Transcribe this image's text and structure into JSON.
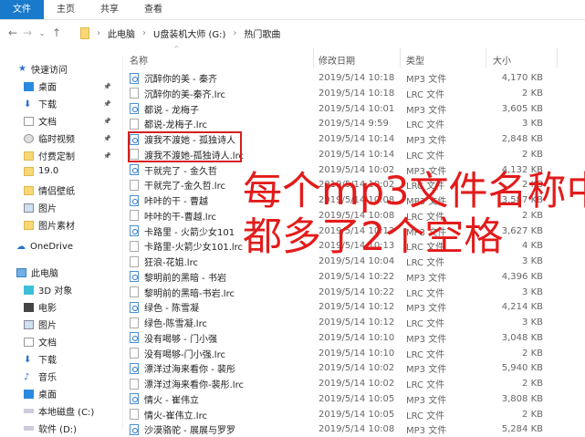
{
  "ribbon": {
    "tabs": [
      "文件",
      "主页",
      "共享",
      "查看"
    ]
  },
  "address": {
    "crumbs": [
      "此电脑",
      "U盘装机大师 (G:)",
      "热门歌曲"
    ]
  },
  "sidebar": {
    "quick_access": "快速访问",
    "items": [
      {
        "label": "桌面",
        "icon": "desktop-icon",
        "pinned": true
      },
      {
        "label": "下载",
        "icon": "download-icon",
        "pinned": true
      },
      {
        "label": "文档",
        "icon": "document-icon",
        "pinned": true
      },
      {
        "label": "临时视频",
        "icon": "disc-icon",
        "pinned": true
      },
      {
        "label": "付费定制",
        "icon": "folder-icon",
        "pinned": true
      },
      {
        "label": "19.0",
        "icon": "folder-icon",
        "pinned": false
      },
      {
        "label": "情侣壁纸",
        "icon": "folder-icon",
        "pinned": false
      },
      {
        "label": "图片",
        "icon": "pictures-icon",
        "pinned": false
      },
      {
        "label": "图片素材",
        "icon": "folder-icon",
        "pinned": false
      }
    ],
    "onedrive": "OneDrive",
    "this_pc": "此电脑",
    "pc_items": [
      {
        "label": "3D 对象",
        "icon": "cube-icon"
      },
      {
        "label": "电影",
        "icon": "video-icon"
      },
      {
        "label": "图片",
        "icon": "pictures-icon"
      },
      {
        "label": "文档",
        "icon": "document-icon"
      },
      {
        "label": "下载",
        "icon": "download-icon"
      },
      {
        "label": "音乐",
        "icon": "music-icon"
      },
      {
        "label": "桌面",
        "icon": "desktop-icon"
      },
      {
        "label": "本地磁盘 (C:)",
        "icon": "drive-icon"
      },
      {
        "label": "软件 (D:)",
        "icon": "drive-icon"
      }
    ]
  },
  "columns": {
    "name": "名称",
    "date": "修改日期",
    "type": "类型",
    "size": "大小"
  },
  "files": [
    {
      "name": "沉醉你的美 - 秦齐",
      "date": "2019/5/14 10:18",
      "type": "MP3 文件",
      "size": "4,170 KB"
    },
    {
      "name": "沉醉你的美-秦齐.lrc",
      "date": "2019/5/14 10:18",
      "type": "LRC 文件",
      "size": "2 KB"
    },
    {
      "name": "都说 - 龙梅子",
      "date": "2019/5/14 10:01",
      "type": "MP3 文件",
      "size": "3,605 KB"
    },
    {
      "name": "都说-龙梅子.lrc",
      "date": "2019/5/14 9:59",
      "type": "LRC 文件",
      "size": "3 KB"
    },
    {
      "name": "渡我不渡她 - 孤独诗人",
      "date": "2019/5/14 10:14",
      "type": "MP3 文件",
      "size": "2,848 KB"
    },
    {
      "name": "渡我不渡她-孤独诗人.lrc",
      "date": "2019/5/14 10:14",
      "type": "LRC 文件",
      "size": "2 KB"
    },
    {
      "name": "干就完了 - 金久哲",
      "date": "2019/5/14 10:02",
      "type": "MP3 文件",
      "size": "4,132 KB"
    },
    {
      "name": "干就完了-金久哲.lrc",
      "date": "2019/5/14 10:02",
      "type": "LRC 文件",
      "size": "2 KB"
    },
    {
      "name": "咔咔的干 - 曹越",
      "date": "2019/5/14 10:08",
      "type": "MP3 文件",
      "size": "3,587 KB"
    },
    {
      "name": "咔咔的干-曹越.lrc",
      "date": "2019/5/14 10:08",
      "type": "LRC 文件",
      "size": "2 KB"
    },
    {
      "name": "卡路里 - 火箭少女101",
      "date": "2019/5/14 10:13",
      "type": "MP3 文件",
      "size": "3,627 KB"
    },
    {
      "name": "卡路里-火箭少女101.lrc",
      "date": "2019/5/14 10:13",
      "type": "LRC 文件",
      "size": "4 KB"
    },
    {
      "name": "狂浪-花姐.lrc",
      "date": "2019/5/14 10:04",
      "type": "LRC 文件",
      "size": "3 KB"
    },
    {
      "name": "黎明前的黑暗 - 书岩",
      "date": "2019/5/14 10:22",
      "type": "MP3 文件",
      "size": "4,396 KB"
    },
    {
      "name": "黎明前的黑暗-书岩.lrc",
      "date": "2019/5/14 10:22",
      "type": "LRC 文件",
      "size": "3 KB"
    },
    {
      "name": "绿色 - 陈雪凝",
      "date": "2019/5/14 10:12",
      "type": "MP3 文件",
      "size": "4,214 KB"
    },
    {
      "name": "绿色-陈雪凝.lrc",
      "date": "2019/5/14 10:12",
      "type": "LRC 文件",
      "size": "3 KB"
    },
    {
      "name": "没有喝够 - 门小强",
      "date": "2019/5/14 10:10",
      "type": "MP3 文件",
      "size": "3,048 KB"
    },
    {
      "name": "没有喝够-门小强.lrc",
      "date": "2019/5/14 10:10",
      "type": "LRC 文件",
      "size": "2 KB"
    },
    {
      "name": "漂洋过海来看你 - 裴彤",
      "date": "2019/5/14 10:02",
      "type": "MP3 文件",
      "size": "5,940 KB"
    },
    {
      "name": "漂洋过海来看你-裴彤.lrc",
      "date": "2019/5/14 10:02",
      "type": "LRC 文件",
      "size": "2 KB"
    },
    {
      "name": "情火 - 崔伟立",
      "date": "2019/5/14 10:05",
      "type": "MP3 文件",
      "size": "3,808 KB"
    },
    {
      "name": "情火-崔伟立.lrc",
      "date": "2019/5/14 10:05",
      "type": "LRC 文件",
      "size": "2 KB"
    },
    {
      "name": "沙漠骆驼 - 展展与罗罗",
      "date": "2019/5/14 10:08",
      "type": "MP3 文件",
      "size": "5,284 KB"
    }
  ],
  "annotation": {
    "line1": "每个mp3文件名称中",
    "line2": "都多了2个空格",
    "color": "#e31b1b"
  }
}
